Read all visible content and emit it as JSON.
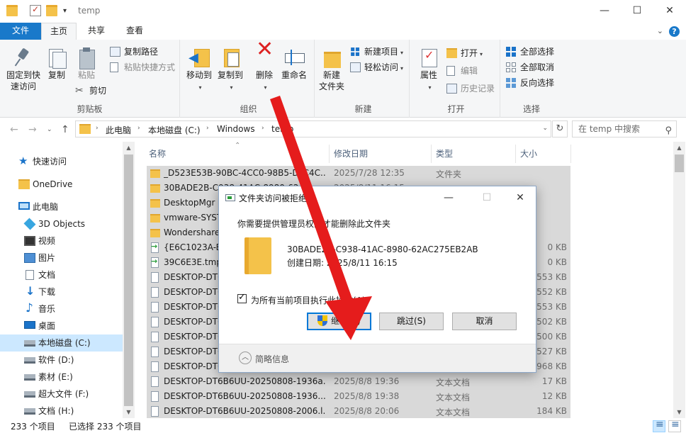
{
  "window": {
    "title": "temp",
    "quick_access_dropdown": "▾",
    "minimize": "—",
    "maximize": "☐",
    "close": "✕"
  },
  "ribbon_tabs": [
    {
      "label": "文件"
    },
    {
      "label": "主页"
    },
    {
      "label": "共享"
    },
    {
      "label": "查看"
    }
  ],
  "ribbon": {
    "clipboard": {
      "label": "剪贴板",
      "pin": "固定到快\n速访问",
      "pin_line1": "固定到快",
      "pin_line2": "速访问",
      "copy": "复制",
      "paste": "粘贴",
      "copy_path": "复制路径",
      "paste_shortcut": "粘贴快捷方式",
      "cut": "剪切"
    },
    "organize": {
      "label": "组织",
      "move_to": "移动到",
      "copy_to": "复制到",
      "delete": "删除",
      "rename": "重命名"
    },
    "new": {
      "label": "新建",
      "new_folder_line1": "新建",
      "new_folder_line2": "文件夹",
      "new_item": "新建项目",
      "easy_access": "轻松访问"
    },
    "open": {
      "label": "打开",
      "properties": "属性",
      "open": "打开",
      "edit": "编辑",
      "history": "历史记录"
    },
    "select": {
      "label": "选择",
      "select_all": "全部选择",
      "select_none": "全部取消",
      "invert": "反向选择"
    }
  },
  "address": {
    "crumbs": [
      "此电脑",
      "本地磁盘 (C:)",
      "Windows",
      "temp"
    ],
    "search_placeholder": "在 temp 中搜索"
  },
  "nav_pane": [
    {
      "label": "快速访问",
      "icon": "star-icon"
    },
    {
      "label": "OneDrive",
      "icon": "cloud-folder-icon"
    },
    {
      "label": "此电脑",
      "icon": "computer-icon"
    },
    {
      "label": "3D Objects",
      "icon": "cube-icon"
    },
    {
      "label": "视频",
      "icon": "video-icon"
    },
    {
      "label": "图片",
      "icon": "picture-icon"
    },
    {
      "label": "文档",
      "icon": "document-icon"
    },
    {
      "label": "下载",
      "icon": "download-icon"
    },
    {
      "label": "音乐",
      "icon": "music-icon"
    },
    {
      "label": "桌面",
      "icon": "desktop-icon"
    },
    {
      "label": "本地磁盘 (C:)",
      "icon": "drive-icon"
    },
    {
      "label": "软件 (D:)",
      "icon": "drive-icon"
    },
    {
      "label": "素材 (E:)",
      "icon": "drive-icon"
    },
    {
      "label": "超大文件 (F:)",
      "icon": "drive-icon"
    },
    {
      "label": "文档 (H:)",
      "icon": "drive-icon"
    }
  ],
  "columns": {
    "name": "名称",
    "date": "修改日期",
    "type": "类型",
    "size": "大小"
  },
  "files": [
    {
      "name": "_D523E53B-90BC-4CC0-98B5-D_C4C...",
      "date": "2025/7/28 12:35",
      "type": "文件夹",
      "size": "",
      "kind": "folder"
    },
    {
      "name": "30BADE2B-C938-41AC-8980-62AC...",
      "date": "2025/8/11 16:15",
      "type": "",
      "size": "",
      "kind": "folder"
    },
    {
      "name": "DesktopMgr",
      "date": "",
      "type": "",
      "size": "",
      "kind": "folder"
    },
    {
      "name": "vmware-SYST...",
      "date": "",
      "type": "",
      "size": "",
      "kind": "folder"
    },
    {
      "name": "Wondershare",
      "date": "",
      "type": "",
      "size": "",
      "kind": "folder"
    },
    {
      "name": "{E6C1023A-BE...",
      "date": "",
      "type": "",
      "size": "0 KB",
      "kind": "tmp"
    },
    {
      "name": "39C6E3E.tmp",
      "date": "",
      "type": "",
      "size": "0 KB",
      "kind": "tmp"
    },
    {
      "name": "DESKTOP-DT6...",
      "date": "",
      "type": "",
      "size": "553 KB",
      "kind": "txt"
    },
    {
      "name": "DESKTOP-DT6...",
      "date": "",
      "type": "",
      "size": "552 KB",
      "kind": "txt"
    },
    {
      "name": "DESKTOP-DT6...",
      "date": "",
      "type": "",
      "size": "553 KB",
      "kind": "txt"
    },
    {
      "name": "DESKTOP-DT6...",
      "date": "",
      "type": "",
      "size": "1,502 KB",
      "kind": "txt"
    },
    {
      "name": "DESKTOP-DT6...",
      "date": "",
      "type": "",
      "size": "1,500 KB",
      "kind": "txt"
    },
    {
      "name": "DESKTOP-DT6...",
      "date": "",
      "type": "",
      "size": "1,527 KB",
      "kind": "txt"
    },
    {
      "name": "DESKTOP-DT6...",
      "date": "",
      "type": "",
      "size": "1,968 KB",
      "kind": "txt"
    },
    {
      "name": "DESKTOP-DT6B6UU-20250808-1936a...",
      "date": "2025/8/8 19:36",
      "type": "文本文档",
      "size": "17 KB",
      "kind": "txt"
    },
    {
      "name": "DESKTOP-DT6B6UU-20250808-1936...",
      "date": "2025/8/8 19:38",
      "type": "文本文档",
      "size": "12 KB",
      "kind": "txt"
    },
    {
      "name": "DESKTOP-DT6B6UU-20250808-2006.l...",
      "date": "2025/8/8 20:06",
      "type": "文本文档",
      "size": "184 KB",
      "kind": "txt"
    }
  ],
  "status": {
    "count": "233 个项目",
    "selected": "已选择 233 个项目"
  },
  "dialog": {
    "title": "文件夹访问被拒绝",
    "message": "你需要提供管理员权限才能删除此文件夹",
    "folder_name": "30BADE2B-C938-41AC-8980-62AC275EB2AB",
    "created": "创建日期: 2025/8/11 16:15",
    "apply_all": "为所有当前项目执行此操作(A)",
    "continue": "继续(C)",
    "skip": "跳过(S)",
    "cancel": "取消",
    "details": "简略信息"
  }
}
